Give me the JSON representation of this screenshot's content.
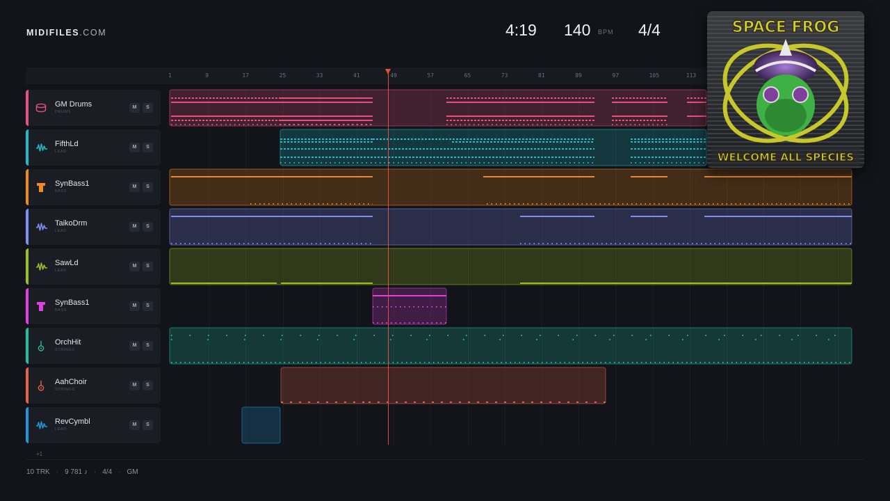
{
  "brand": {
    "name": "MIDIFILES",
    "domain": ".COM"
  },
  "transport": {
    "time": "4:19",
    "bpm": "140",
    "bpm_unit": "BPM",
    "signature": "4/4"
  },
  "ruler": {
    "ticks": [
      "1",
      "9",
      "17",
      "25",
      "33",
      "41",
      "49",
      "57",
      "65",
      "73",
      "81",
      "89",
      "97",
      "105",
      "113"
    ]
  },
  "playhead": {
    "bar": 49
  },
  "album": {
    "title": "SPACE FROG",
    "caption": "WELCOME ALL SPECIES"
  },
  "tracks": [
    {
      "name": "GM Drums",
      "category": "DRUMS",
      "color": "#e8507e",
      "icon": "drum-icon"
    },
    {
      "name": "FifthLd",
      "category": "LEAD",
      "color": "#22b9c9",
      "icon": "wave-icon"
    },
    {
      "name": "SynBass1",
      "category": "BASS",
      "color": "#f08a1c",
      "icon": "bass-icon"
    },
    {
      "name": "TaikoDrm",
      "category": "LEAD",
      "color": "#7f8ef0",
      "icon": "wave-icon"
    },
    {
      "name": "SawLd",
      "category": "LEAD",
      "color": "#9cbf1f",
      "icon": "wave-icon"
    },
    {
      "name": "SynBass1",
      "category": "BASS",
      "color": "#e040e0",
      "icon": "bass-icon"
    },
    {
      "name": "OrchHit",
      "category": "STRINGS",
      "color": "#1fbfa1",
      "icon": "guitar-icon"
    },
    {
      "name": "AahChoir",
      "category": "STRINGS",
      "color": "#e4634a",
      "icon": "guitar-icon"
    },
    {
      "name": "RevCymbl",
      "category": "LEAD",
      "color": "#1e98d8",
      "icon": "wave-icon"
    }
  ],
  "buttons": {
    "mute": "M",
    "solo": "S"
  },
  "more_tracks": "+1",
  "footer": {
    "tracks": "10 TRK",
    "notes": "9 781 ♪",
    "signature": "4/4",
    "standard": "GM"
  }
}
